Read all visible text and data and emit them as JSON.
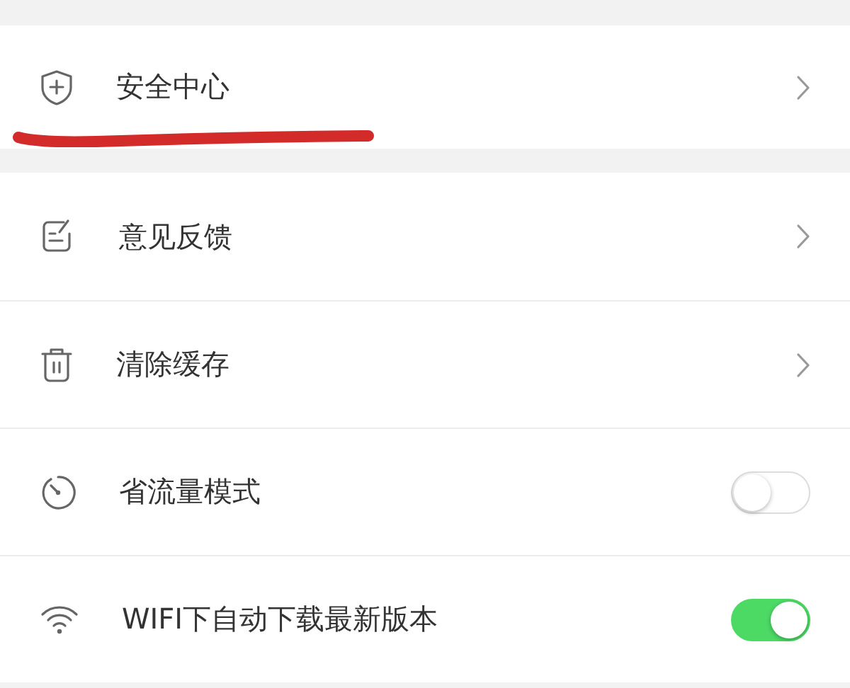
{
  "groups": [
    {
      "items": [
        {
          "label": "安全中心",
          "kind": "link",
          "highlighted": true
        }
      ]
    },
    {
      "items": [
        {
          "label": "意见反馈",
          "kind": "link",
          "highlighted": false
        },
        {
          "label": "清除缓存",
          "kind": "link",
          "highlighted": false
        },
        {
          "label": "省流量模式",
          "kind": "toggle",
          "on": false,
          "highlighted": false
        },
        {
          "label": "WIFI下自动下载最新版本",
          "kind": "toggle",
          "on": true,
          "highlighted": false
        }
      ]
    }
  ]
}
